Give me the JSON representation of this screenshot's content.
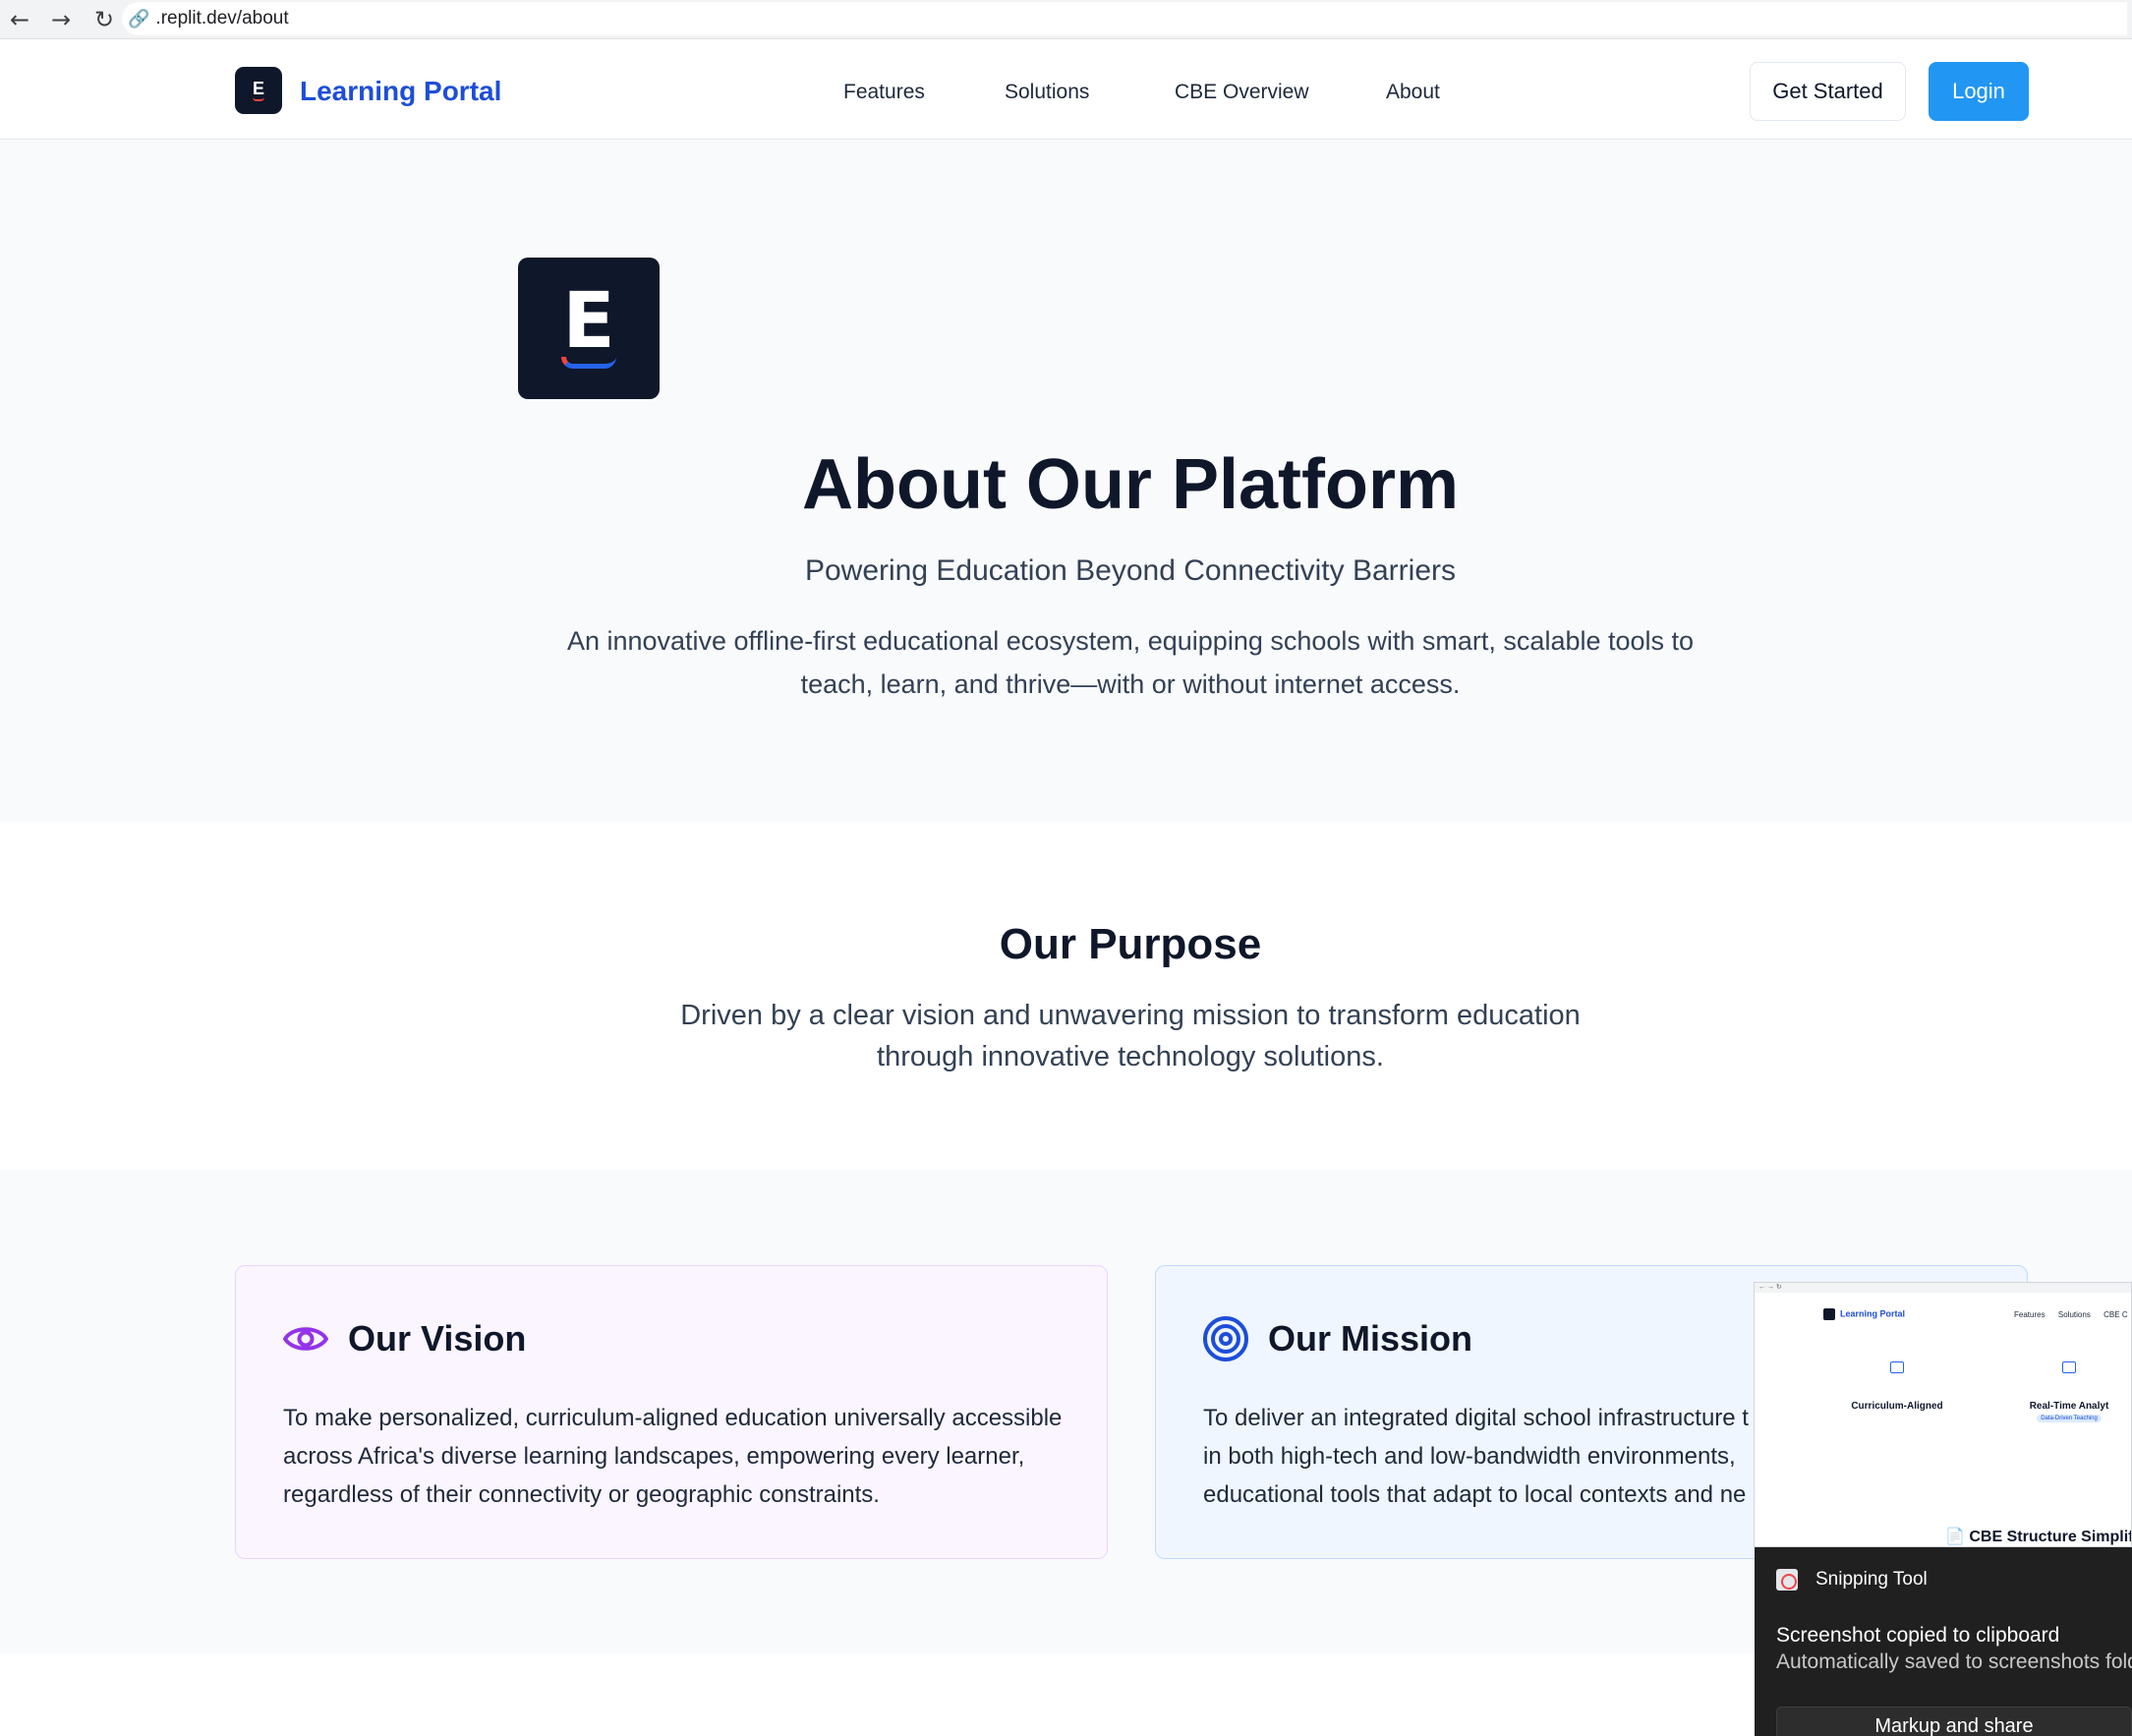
{
  "browser": {
    "url": ".replit.dev/about",
    "back_icon": "arrow-left-icon",
    "forward_icon": "arrow-right-icon",
    "reload_icon": "reload-icon"
  },
  "navbar": {
    "brand_letter": "E",
    "brand_name": "Learning Portal",
    "links": [
      "Features",
      "Solutions",
      "CBE Overview",
      "About"
    ],
    "get_started": "Get Started",
    "login": "Login"
  },
  "hero": {
    "logo_letter": "E",
    "title": "About Our Platform",
    "subtitle": "Powering Education Beyond Connectivity Barriers",
    "description": "An innovative offline-first educational ecosystem, equipping schools with smart, scalable tools to teach, learn, and thrive—with or without internet access."
  },
  "purpose": {
    "title": "Our Purpose",
    "description": "Driven by a clear vision and unwavering mission to transform education through innovative technology solutions."
  },
  "cards": {
    "vision": {
      "icon": "eye-icon",
      "title": "Our Vision",
      "text": "To make personalized, curriculum-aligned education universally accessible across Africa's diverse learning landscapes, empowering every learner, regardless of their connectivity or geographic constraints."
    },
    "mission": {
      "icon": "target-icon",
      "title": "Our Mission",
      "text": "To deliver an integrated digital school infrastructure t in both high-tech and low-bandwidth environments, educational tools that adapt to local contexts and ne"
    }
  },
  "snipping": {
    "thumbnail": {
      "brand": "Learning Portal",
      "links": "Features      Solutions      CBE C",
      "col1_title": "Curriculum-Aligned",
      "col2_title": "Real-Time Analyt",
      "chip": "Data-Driven Teaching",
      "bottom_heading": "CBE Structure Simplifi"
    },
    "app_name": "Snipping Tool",
    "message": "Screenshot copied to clipboard",
    "sub_message": "Automatically saved to screenshots fold",
    "button": "Markup and share"
  },
  "colors": {
    "brand_blue": "#1d4ed8",
    "login_blue": "#2196f3",
    "vision_purple": "#9333ea",
    "mission_blue": "#1d4ed8",
    "dark_navy": "#0f172a"
  }
}
